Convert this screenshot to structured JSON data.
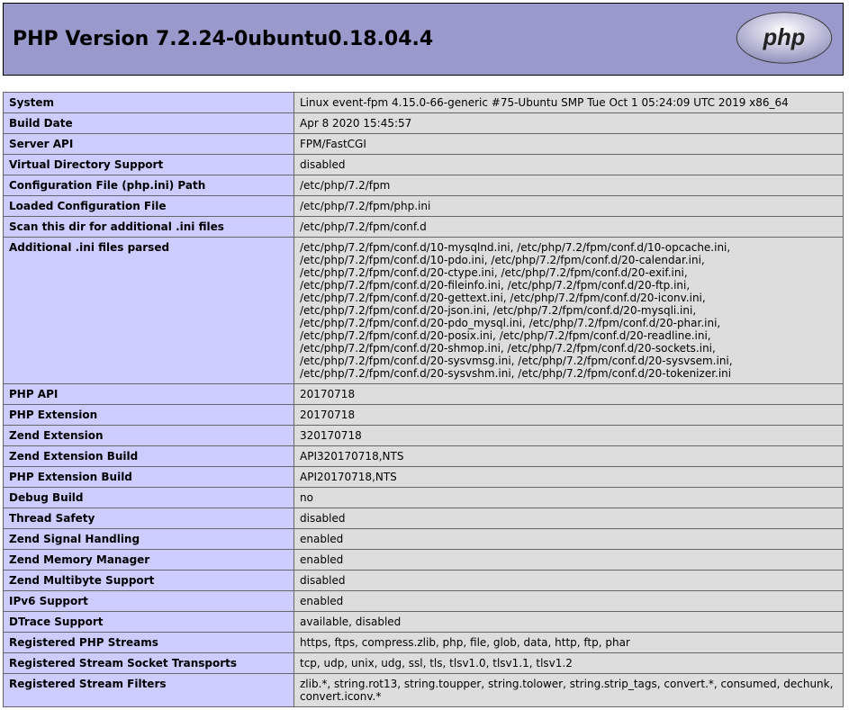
{
  "header": {
    "title": "PHP Version 7.2.24-0ubuntu0.18.04.4"
  },
  "rows": [
    {
      "label": "System",
      "value": "Linux event-fpm 4.15.0-66-generic #75-Ubuntu SMP Tue Oct 1 05:24:09 UTC 2019 x86_64"
    },
    {
      "label": "Build Date",
      "value": "Apr 8 2020 15:45:57"
    },
    {
      "label": "Server API",
      "value": "FPM/FastCGI"
    },
    {
      "label": "Virtual Directory Support",
      "value": "disabled"
    },
    {
      "label": "Configuration File (php.ini) Path",
      "value": "/etc/php/7.2/fpm"
    },
    {
      "label": "Loaded Configuration File",
      "value": "/etc/php/7.2/fpm/php.ini"
    },
    {
      "label": "Scan this dir for additional .ini files",
      "value": "/etc/php/7.2/fpm/conf.d"
    },
    {
      "label": "Additional .ini files parsed",
      "value": "/etc/php/7.2/fpm/conf.d/10-mysqlnd.ini, /etc/php/7.2/fpm/conf.d/10-opcache.ini, /etc/php/7.2/fpm/conf.d/10-pdo.ini, /etc/php/7.2/fpm/conf.d/20-calendar.ini, /etc/php/7.2/fpm/conf.d/20-ctype.ini, /etc/php/7.2/fpm/conf.d/20-exif.ini, /etc/php/7.2/fpm/conf.d/20-fileinfo.ini, /etc/php/7.2/fpm/conf.d/20-ftp.ini, /etc/php/7.2/fpm/conf.d/20-gettext.ini, /etc/php/7.2/fpm/conf.d/20-iconv.ini, /etc/php/7.2/fpm/conf.d/20-json.ini, /etc/php/7.2/fpm/conf.d/20-mysqli.ini, /etc/php/7.2/fpm/conf.d/20-pdo_mysql.ini, /etc/php/7.2/fpm/conf.d/20-phar.ini, /etc/php/7.2/fpm/conf.d/20-posix.ini, /etc/php/7.2/fpm/conf.d/20-readline.ini, /etc/php/7.2/fpm/conf.d/20-shmop.ini, /etc/php/7.2/fpm/conf.d/20-sockets.ini, /etc/php/7.2/fpm/conf.d/20-sysvmsg.ini, /etc/php/7.2/fpm/conf.d/20-sysvsem.ini, /etc/php/7.2/fpm/conf.d/20-sysvshm.ini, /etc/php/7.2/fpm/conf.d/20-tokenizer.ini"
    },
    {
      "label": "PHP API",
      "value": "20170718"
    },
    {
      "label": "PHP Extension",
      "value": "20170718"
    },
    {
      "label": "Zend Extension",
      "value": "320170718"
    },
    {
      "label": "Zend Extension Build",
      "value": "API320170718,NTS"
    },
    {
      "label": "PHP Extension Build",
      "value": "API20170718,NTS"
    },
    {
      "label": "Debug Build",
      "value": "no"
    },
    {
      "label": "Thread Safety",
      "value": "disabled"
    },
    {
      "label": "Zend Signal Handling",
      "value": "enabled"
    },
    {
      "label": "Zend Memory Manager",
      "value": "enabled"
    },
    {
      "label": "Zend Multibyte Support",
      "value": "disabled"
    },
    {
      "label": "IPv6 Support",
      "value": "enabled"
    },
    {
      "label": "DTrace Support",
      "value": "available, disabled"
    },
    {
      "label": "Registered PHP Streams",
      "value": "https, ftps, compress.zlib, php, file, glob, data, http, ftp, phar"
    },
    {
      "label": "Registered Stream Socket Transports",
      "value": "tcp, udp, unix, udg, ssl, tls, tlsv1.0, tlsv1.1, tlsv1.2"
    },
    {
      "label": "Registered Stream Filters",
      "value": "zlib.*, string.rot13, string.toupper, string.tolower, string.strip_tags, convert.*, consumed, dechunk, convert.iconv.*"
    }
  ]
}
